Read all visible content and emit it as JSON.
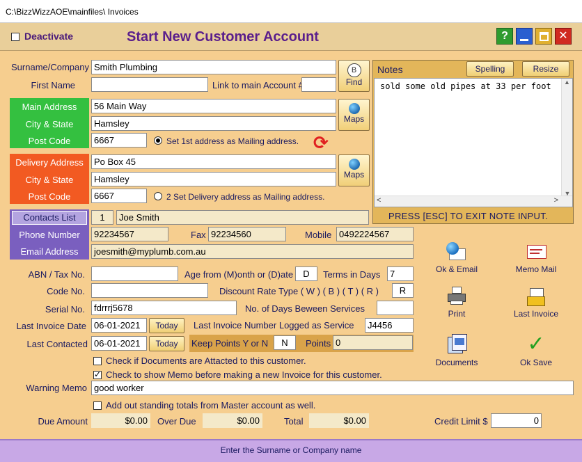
{
  "window": {
    "title": "C:\\BizzWizzAOE\\mainfiles\\ Invoices"
  },
  "header": {
    "deactivate_label": "Deactivate",
    "title": "Start New Customer Account",
    "help_label": "?"
  },
  "form": {
    "surname_label": "Surname/Company",
    "surname_value": "Smith Plumbing",
    "first_name_label": "First Name",
    "first_name_value": "",
    "link_label": "Link to main Account #",
    "link_value": "",
    "find_label": "Find",
    "main_address_label": "Main Address",
    "main_address_value": "56 Main Way",
    "main_city_label": "City & State",
    "main_city_value": "Hamsley",
    "main_post_label": "Post Code",
    "main_post_value": "6667",
    "maps_label": "Maps",
    "mailing1_label": "Set 1st address as Mailing address.",
    "delivery_address_label": "Delivery Address",
    "delivery_address_value": "Po Box 45",
    "delivery_city_label": "City & State",
    "delivery_city_value": "Hamsley",
    "delivery_post_label": "Post Code",
    "delivery_post_value": "6667",
    "mailing2_label": "2 Set Delivery address as Mailing address.",
    "contacts_label": "Contacts List",
    "contact_index": "1",
    "contact_name": "Joe Smith",
    "phone_label": "Phone Number",
    "phone_value": "92234567",
    "fax_label": "Fax",
    "fax_value": "92234560",
    "mobile_label": "Mobile",
    "mobile_value": "0492224567",
    "email_label": "Email Address",
    "email_value": "joesmith@myplumb.com.au",
    "abn_label": "ABN / Tax No.",
    "abn_value": "",
    "age_label": "Age from (M)onth or (D)ate",
    "age_value": "D",
    "terms_label": "Terms in Days",
    "terms_value": "7",
    "code_label": "Code No.",
    "code_value": "",
    "discount_label": "Discount Rate Type ( W ) ( B ) ( T ) ( R )",
    "discount_value": "R",
    "serial_label": "Serial No.",
    "serial_value": "fdrrrj5678",
    "days_between_label": "No. of Days Beween Services",
    "days_between_value": "",
    "last_invoice_date_label": "Last Invoice Date",
    "last_invoice_date_value": "06-01-2021",
    "today_label": "Today",
    "last_invoice_number_label": "Last Invoice Number Logged as Service",
    "last_invoice_number_value": "J4456",
    "last_contacted_label": "Last Contacted",
    "last_contacted_value": "06-01-2021",
    "keep_points_label": "Keep Points Y or N",
    "keep_points_value": "N",
    "points_label": "Points",
    "points_value": "0",
    "docs_attached_label": "Check if Documents are Attacted to this customer.",
    "show_memo_label": "Check to show Memo before making a new Invoice for this customer.",
    "warning_memo_label": "Warning Memo",
    "warning_memo_value": "good worker",
    "add_totals_label": "Add out standing totals from Master account as well.",
    "due_amount_label": "Due Amount",
    "due_amount_value": "$0.00",
    "over_due_label": "Over Due",
    "over_due_value": "$0.00",
    "total_label": "Total",
    "total_value": "$0.00",
    "credit_limit_label": "Credit Limit $",
    "credit_limit_value": "0"
  },
  "notes": {
    "title": "Notes",
    "spelling_label": "Spelling",
    "resize_label": "Resize",
    "text": "sold some old pipes at 33 per foot",
    "esc_hint": "PRESS [ESC] TO EXIT NOTE INPUT."
  },
  "actions": {
    "ok_email": "Ok & Email",
    "memo_mail": "Memo Mail",
    "print": "Print",
    "last_invoice": "Last Invoice",
    "documents": "Documents",
    "ok_save": "Ok Save"
  },
  "status": {
    "text": "Enter  the Surname or Company name"
  },
  "colors": {
    "background": "#f6ce8f",
    "green_panel": "#34c040",
    "orange_panel": "#f25a22",
    "purple_panel": "#7a5fbf",
    "title_purple": "#5a1e8c"
  }
}
